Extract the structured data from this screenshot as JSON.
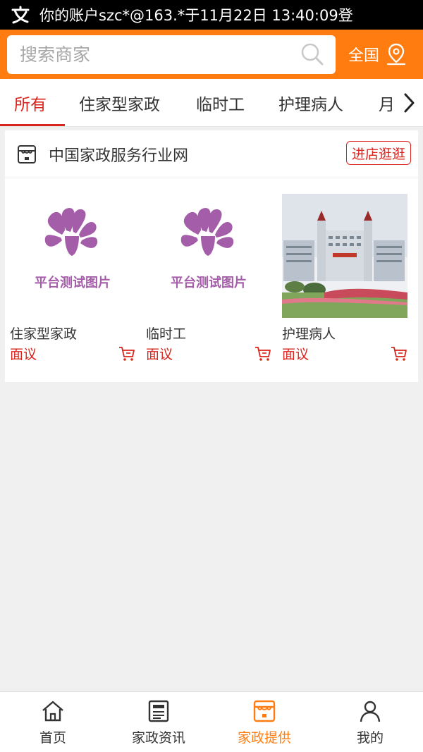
{
  "status_bar": {
    "notification": "你的账户szc*@163.*于11月22日 13:40:09登"
  },
  "header": {
    "search_placeholder": "搜索商家",
    "region_label": "全国",
    "accent_color": "#ff7c11"
  },
  "tabs": [
    {
      "label": "所有",
      "active": true
    },
    {
      "label": "住家型家政",
      "active": false
    },
    {
      "label": "临时工",
      "active": false
    },
    {
      "label": "护理病人",
      "active": false
    },
    {
      "label": "月",
      "active": false
    }
  ],
  "shop": {
    "name": "中国家政服务行业网",
    "visit_label": "进店逛逛",
    "products": [
      {
        "name": "住家型家政",
        "price": "面议",
        "image": "placeholder-logo",
        "image_text": "平台测试图片"
      },
      {
        "name": "临时工",
        "price": "面议",
        "image": "placeholder-logo",
        "image_text": "平台测试图片"
      },
      {
        "name": "护理病人",
        "price": "面议",
        "image": "hospital-photo"
      }
    ]
  },
  "bottom_nav": [
    {
      "label": "首页",
      "icon": "home-icon",
      "active": false
    },
    {
      "label": "家政资讯",
      "icon": "news-icon",
      "active": false
    },
    {
      "label": "家政提供",
      "icon": "shop-icon",
      "active": true
    },
    {
      "label": "我的",
      "icon": "user-icon",
      "active": false
    }
  ]
}
